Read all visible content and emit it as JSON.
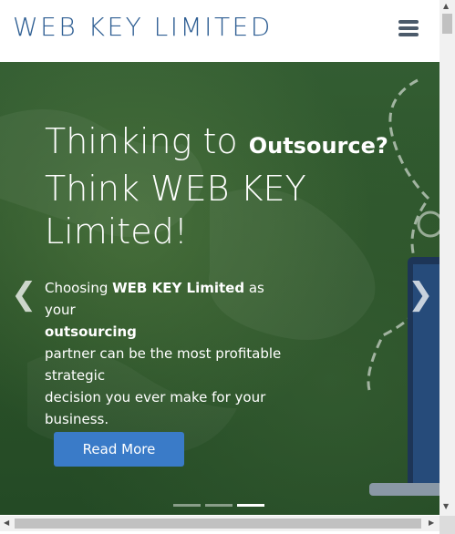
{
  "header": {
    "logo": "WEB KEY LIMITED",
    "menu_icon": "hamburger-menu-icon"
  },
  "hero": {
    "headline_part1": "Thinking to ",
    "headline_bold": "Outsource?",
    "headline_line2": "Think WEB KEY",
    "headline_line3": "Limited!",
    "sub_prefix": "Choosing ",
    "sub_bold1": "WEB KEY Limited",
    "sub_mid": " as your",
    "sub_bold2": "outsourcing",
    "sub_line3": "partner can be the most profitable",
    "sub_line4": "strategic",
    "sub_line5": "decision you ever make for your",
    "sub_line6": "business.",
    "cta_label": "Read More",
    "prev_icon": "chevron-left-icon",
    "next_icon": "chevron-right-icon",
    "slide_count": 3,
    "active_slide": 3
  },
  "colors": {
    "logo": "#2e5e93",
    "hero_bg": "#2b5229",
    "cta": "#3a7bc8"
  }
}
